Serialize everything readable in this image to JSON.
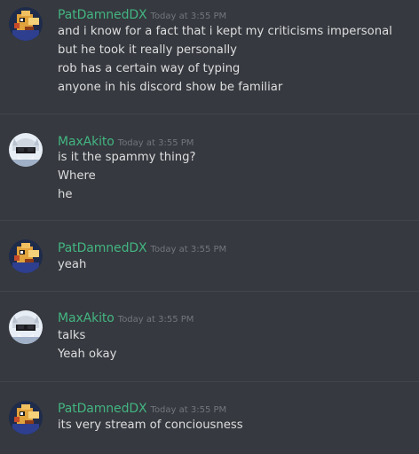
{
  "messages": [
    {
      "author": "PatDamnedDX",
      "avatar_icon": "pat-avatar-icon",
      "timestamp": "Today at 3:55 PM",
      "lines": [
        "and i know for a fact that i kept my criticisms impersonal",
        "but he took it really personally",
        "rob has a certain way of typing",
        "anyone in his discord show be familiar"
      ]
    },
    {
      "author": "MaxAkito",
      "avatar_icon": "max-avatar-icon",
      "timestamp": "Today at 3:55 PM",
      "lines": [
        "is it the spammy thing?",
        "Where",
        "he"
      ]
    },
    {
      "author": "PatDamnedDX",
      "avatar_icon": "pat-avatar-icon",
      "timestamp": "Today at 3:55 PM",
      "lines": [
        "yeah"
      ]
    },
    {
      "author": "MaxAkito",
      "avatar_icon": "max-avatar-icon",
      "timestamp": "Today at 3:55 PM",
      "lines": [
        "talks",
        "Yeah okay"
      ]
    },
    {
      "author": "PatDamnedDX",
      "avatar_icon": "pat-avatar-icon",
      "timestamp": "Today at 3:55 PM",
      "lines": [
        "its very stream of conciousness"
      ]
    }
  ],
  "colors": {
    "background": "#36393f",
    "username": "#43b581",
    "timestamp": "#72767d",
    "message_text": "#dcddde",
    "divider": "#42454b"
  }
}
